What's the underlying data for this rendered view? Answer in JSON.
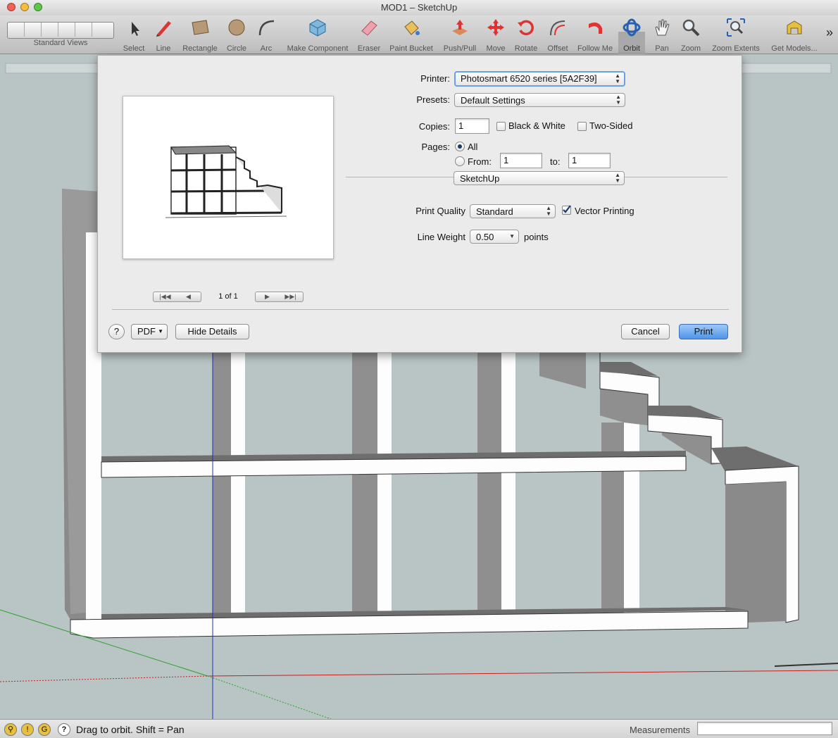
{
  "window": {
    "title": "MOD1 – SketchUp"
  },
  "toolbar": {
    "tools": [
      {
        "name": "standard-views",
        "label": "Standard Views"
      },
      {
        "name": "select",
        "label": "Select"
      },
      {
        "name": "line",
        "label": "Line"
      },
      {
        "name": "rectangle",
        "label": "Rectangle"
      },
      {
        "name": "circle",
        "label": "Circle"
      },
      {
        "name": "arc",
        "label": "Arc"
      },
      {
        "name": "make-component",
        "label": "Make Component"
      },
      {
        "name": "eraser",
        "label": "Eraser"
      },
      {
        "name": "paint-bucket",
        "label": "Paint Bucket"
      },
      {
        "name": "push-pull",
        "label": "Push/Pull"
      },
      {
        "name": "move",
        "label": "Move"
      },
      {
        "name": "rotate",
        "label": "Rotate"
      },
      {
        "name": "offset",
        "label": "Offset"
      },
      {
        "name": "follow-me",
        "label": "Follow Me"
      },
      {
        "name": "orbit",
        "label": "Orbit"
      },
      {
        "name": "pan",
        "label": "Pan"
      },
      {
        "name": "zoom",
        "label": "Zoom"
      },
      {
        "name": "zoom-extents",
        "label": "Zoom Extents"
      },
      {
        "name": "get-models",
        "label": "Get Models..."
      }
    ],
    "overflow_label": "»"
  },
  "print": {
    "printer_label": "Printer:",
    "printer_value": "Photosmart 6520 series [5A2F39]",
    "presets_label": "Presets:",
    "presets_value": "Default Settings",
    "copies_label": "Copies:",
    "copies_value": "1",
    "bw_label": "Black & White",
    "bw_checked": false,
    "twosided_label": "Two-Sided",
    "twosided_checked": false,
    "pages_label": "Pages:",
    "all_label": "All",
    "from_label": "From:",
    "from_value": "1",
    "to_label": "to:",
    "to_value": "1",
    "section_value": "SketchUp",
    "quality_label": "Print Quality",
    "quality_value": "Standard",
    "vector_label": "Vector Printing",
    "vector_checked": true,
    "lineweight_label": "Line Weight",
    "lineweight_value": "0.50",
    "points_label": "points",
    "page_indicator": "1 of 1",
    "help_label": "?",
    "pdf_label": "PDF",
    "hide_details_label": "Hide Details",
    "cancel_label": "Cancel",
    "print_label": "Print"
  },
  "status": {
    "help_label": "?",
    "message": "Drag to orbit.  Shift = Pan",
    "measurements_label": "Measurements",
    "measurements_value": ""
  },
  "colors": {
    "canvas": "#b9c4c4",
    "accent": "#4f95e8",
    "dark_face": "#8a8a8a"
  }
}
